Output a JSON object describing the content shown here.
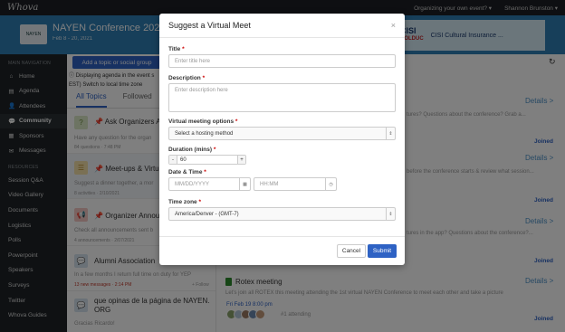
{
  "topbar": {
    "brand": "Whova",
    "organizing": "Organizing your own event? ▾",
    "user": "Shannon Brunston ▾"
  },
  "banner": {
    "title": "NAYEN Conference 2021",
    "dates": "Feb 8 - 20, 2021",
    "sponsor_logo_top": "CISI",
    "sponsor_logo_bottom": "BOLDUC",
    "sponsor_name": "CISI Cultural Insurance ..."
  },
  "sidebar": {
    "nav_heading": "MAIN NAVIGATION",
    "items": [
      {
        "label": "Home",
        "icon": "home-icon",
        "glyph": "⌂"
      },
      {
        "label": "Agenda",
        "icon": "calendar-icon",
        "glyph": "▤"
      },
      {
        "label": "Attendees",
        "icon": "people-icon",
        "glyph": "👤"
      },
      {
        "label": "Community",
        "icon": "chat-icon",
        "glyph": "💬"
      },
      {
        "label": "Sponsors",
        "icon": "sponsor-icon",
        "glyph": "▦"
      },
      {
        "label": "Messages",
        "icon": "message-icon",
        "glyph": "✉"
      }
    ],
    "resources_heading": "RESOURCES",
    "resources": [
      "Session Q&A",
      "Video Gallery",
      "Documents",
      "Logistics",
      "Polls",
      "Powerpoint",
      "Speakers",
      "Surveys",
      "Twitter",
      "Whova Guides"
    ]
  },
  "main": {
    "add_button": "Add a topic or social group",
    "agenda_note_1": "ⓘ Displaying agenda in the event s",
    "agenda_note_2": "EST) Switch to local time zone",
    "tabs": [
      "All Topics",
      "Followed"
    ],
    "topics": [
      {
        "title": "Ask Organizers A",
        "desc": "Have any question for the organ",
        "meta": "84 questions · 7:48 PM"
      },
      {
        "title": "Meet-ups & Virtu",
        "desc": "Suggest a dinner together, a mor",
        "meta": "8 activities · 2/10/2021"
      },
      {
        "title": "Organizer Announ",
        "desc": "Check all announcements sent b",
        "meta": "4 announcements · 2/07/2021"
      },
      {
        "title": "Alumni Association",
        "desc": "In a few months I return full time on duty for YEP",
        "meta": "13 new messages · 2:14 PM",
        "follow": "+ Follow"
      },
      {
        "title": "que opinas de la página de NAYEN. ORG",
        "desc": "Gracias Ricardo!"
      }
    ],
    "details_label": "Details >",
    "joined_label": "Joined",
    "right_desc_1": "tures? Questions about the conference? Grab a...",
    "right_desc_2": "before the conference starts & review what session...",
    "right_desc_3": "tures in the app? Questions about the conference?...",
    "rotex_title": "Rotex meeting",
    "rotex_desc": "Let's join all ROTEX this meeting attending the 1st virtual NAYEN Conference to meet each other and take a picture",
    "rotex_date": "Fri Feb 19 8:00 pm",
    "rotex_attending": "#1 attending"
  },
  "modal": {
    "title": "Suggest a Virtual Meet",
    "close": "×",
    "title_label": "Title",
    "title_placeholder": "Enter title here",
    "desc_label": "Description",
    "desc_placeholder": "Enter description here",
    "options_label": "Virtual meeting options",
    "options_value": "Select a hosting method",
    "duration_label": "Duration (mins)",
    "duration_minus": "-",
    "duration_value": "60",
    "duration_plus": "+",
    "datetime_label": "Date & Time",
    "date_placeholder": "MM/DD/YYYY",
    "time_placeholder": "HH:MM",
    "timezone_label": "Time zone",
    "timezone_value": "America/Denver - (GMT-7)",
    "cancel": "Cancel",
    "submit": "Submit",
    "required_mark": "*"
  }
}
